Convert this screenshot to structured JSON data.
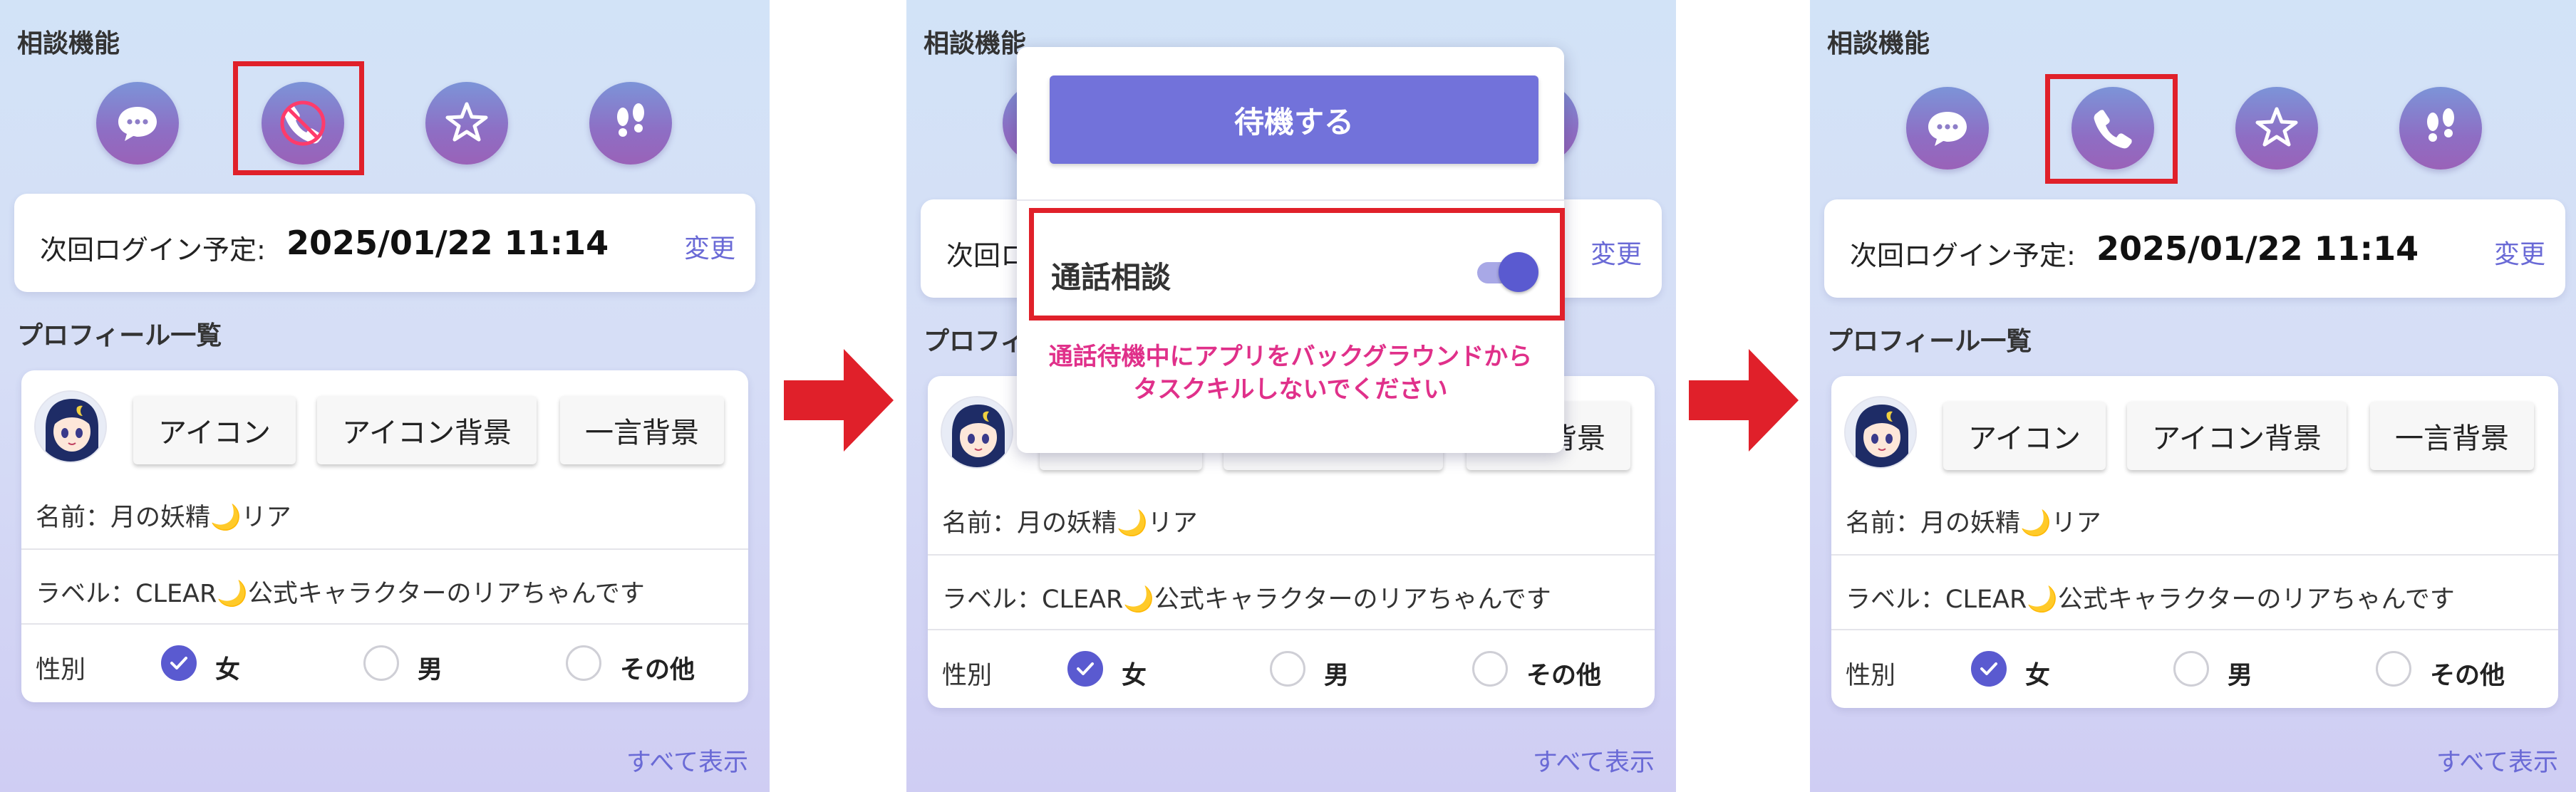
{
  "consult_title": "相談機能",
  "profile_title": "プロフィール一覧",
  "login": {
    "label": "次回ログイン予定:",
    "date": "2025/01/22 11:14",
    "change": "変更"
  },
  "profile": {
    "buttons": [
      "アイコン",
      "アイコン背景",
      "一言背景"
    ],
    "name": "名前：月の妖精🌙リア",
    "label": "ラベル：CLEAR🌙公式キャラクターのリアちゃんです",
    "gender_label": "性別",
    "gender_options": [
      "女",
      "男",
      "その他"
    ],
    "gender_selected": "女"
  },
  "see_all": "すべて表示",
  "popup": {
    "standby_button": "待機する",
    "call_consult_label": "通話相談",
    "call_consult_enabled": true,
    "warning": "通話待機中にアプリをバックグラウンドからタスクキルしないでください"
  },
  "icons": [
    "chat-bubble-icon",
    "phone-icon",
    "star-icon",
    "footprints-icon"
  ],
  "colors": {
    "accent": "#6a6ad6",
    "highlight": "#e0202a",
    "warning": "#e0308a",
    "arrow": "#e0202a"
  }
}
